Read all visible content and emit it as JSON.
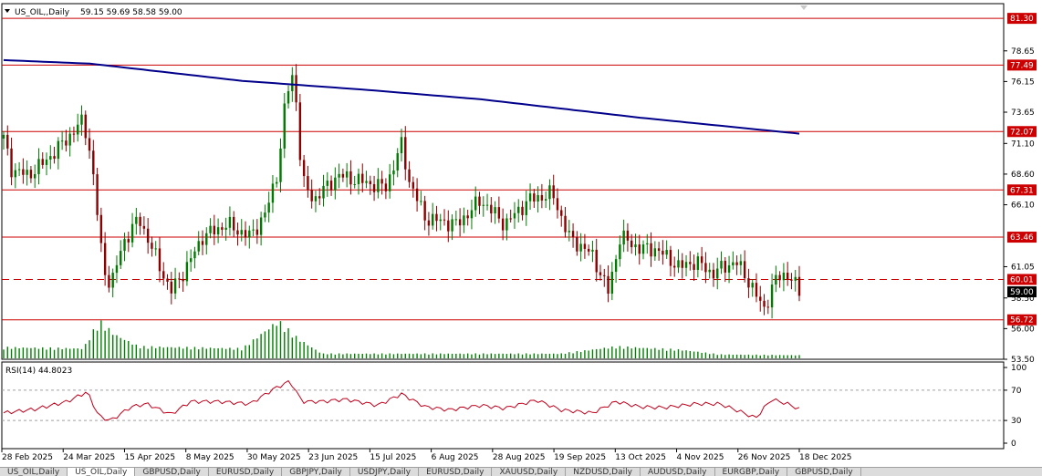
{
  "header": {
    "symbol": "US_OIL,,Daily",
    "ohlc": "59.15 59.69 58.58 59.00"
  },
  "rsi": {
    "label": "RSI(14) 44.8023",
    "value": 44.8023,
    "levels": [
      70,
      30
    ],
    "ticks": [
      "100",
      "70",
      "30",
      "0"
    ]
  },
  "price_label": "59.00",
  "colors": {
    "bull": "#007a00",
    "bear": "#8b0000",
    "ma": "#00008b",
    "hline": "#cc0000",
    "rsi_line": "#c0001c",
    "volume": "#008000",
    "badge_bg": "#cc0000",
    "badge_text": "#ffffff"
  },
  "tabs": [
    "US_OIL,Daily",
    "US_OIL,Daily",
    "GBPUSD,Daily",
    "EURUSD,Daily",
    "GBPJPY,Daily",
    "USDJPY,Daily",
    "EURUSD,Daily",
    "XAUUSD,Daily",
    "NZDUSD,Daily",
    "AUDUSD,Daily",
    "EURGBP,Daily",
    "GBPUSD,Daily"
  ],
  "chart_data": {
    "type": "candlestick",
    "ylim": [
      53.5,
      82.5
    ],
    "y_ticks": [
      "78.65",
      "76.15",
      "73.65",
      "71.10",
      "68.60",
      "66.10",
      "61.05",
      "58.50",
      "56.00",
      "53.50"
    ],
    "x_ticks": [
      "28 Feb 2025",
      "24 Mar 2025",
      "15 Apr 2025",
      "8 May 2025",
      "30 May 2025",
      "23 Jun 2025",
      "15 Jul 2025",
      "6 Aug 2025",
      "28 Aug 2025",
      "19 Sep 2025",
      "13 Oct 2025",
      "4 Nov 2025",
      "26 Nov 2025",
      "18 Dec 2025"
    ],
    "horizontal_levels": [
      {
        "value": 81.3,
        "label": "81.30",
        "style": "solid"
      },
      {
        "value": 77.49,
        "label": "77.49",
        "style": "solid"
      },
      {
        "value": 72.07,
        "label": "72.07",
        "style": "solid"
      },
      {
        "value": 67.31,
        "label": "67.31",
        "style": "solid"
      },
      {
        "value": 63.46,
        "label": "63.46",
        "style": "solid"
      },
      {
        "value": 60.01,
        "label": "60.01",
        "style": "dashed"
      },
      {
        "value": 56.72,
        "label": "56.72",
        "style": "solid"
      }
    ],
    "current_price": 59.0,
    "ma_line": [
      [
        0,
        77.9
      ],
      [
        0.11,
        77.6
      ],
      [
        0.3,
        76.2
      ],
      [
        0.45,
        75.5
      ],
      [
        0.6,
        74.7
      ],
      [
        0.8,
        73.2
      ],
      [
        1.0,
        71.9
      ]
    ],
    "close_path": [
      [
        0,
        71.5
      ],
      [
        0.01,
        69.0
      ],
      [
        0.03,
        68.5
      ],
      [
        0.05,
        69.5
      ],
      [
        0.08,
        71.5
      ],
      [
        0.1,
        73.0
      ],
      [
        0.11,
        70.0
      ],
      [
        0.125,
        61.0
      ],
      [
        0.135,
        59.5
      ],
      [
        0.15,
        63.0
      ],
      [
        0.17,
        65.0
      ],
      [
        0.19,
        62.0
      ],
      [
        0.21,
        59.0
      ],
      [
        0.23,
        61.0
      ],
      [
        0.25,
        63.5
      ],
      [
        0.28,
        64.5
      ],
      [
        0.31,
        63.5
      ],
      [
        0.33,
        65.5
      ],
      [
        0.345,
        69.0
      ],
      [
        0.355,
        75.0
      ],
      [
        0.365,
        77.0
      ],
      [
        0.375,
        68.0
      ],
      [
        0.39,
        66.5
      ],
      [
        0.42,
        68.5
      ],
      [
        0.45,
        68.0
      ],
      [
        0.48,
        67.5
      ],
      [
        0.5,
        71.0
      ],
      [
        0.51,
        68.0
      ],
      [
        0.53,
        65.0
      ],
      [
        0.57,
        64.5
      ],
      [
        0.6,
        66.5
      ],
      [
        0.63,
        64.5
      ],
      [
        0.66,
        66.5
      ],
      [
        0.69,
        67.0
      ],
      [
        0.71,
        63.5
      ],
      [
        0.74,
        62.0
      ],
      [
        0.76,
        59.0
      ],
      [
        0.775,
        63.5
      ],
      [
        0.8,
        62.5
      ],
      [
        0.82,
        62.5
      ],
      [
        0.85,
        61.0
      ],
      [
        0.87,
        61.5
      ],
      [
        0.89,
        60.5
      ],
      [
        0.92,
        61.5
      ],
      [
        0.94,
        59.5
      ],
      [
        0.955,
        57.5
      ],
      [
        0.97,
        60.0
      ],
      [
        0.985,
        60.5
      ],
      [
        1.0,
        59.0
      ]
    ],
    "volume_path": [
      [
        0,
        0.28
      ],
      [
        0.1,
        0.25
      ],
      [
        0.12,
        0.95
      ],
      [
        0.14,
        0.6
      ],
      [
        0.17,
        0.3
      ],
      [
        0.3,
        0.25
      ],
      [
        0.345,
        0.95
      ],
      [
        0.37,
        0.5
      ],
      [
        0.4,
        0.12
      ],
      [
        0.7,
        0.12
      ],
      [
        0.77,
        0.3
      ],
      [
        0.85,
        0.22
      ],
      [
        0.9,
        0.1
      ],
      [
        1.0,
        0.08
      ]
    ],
    "rsi_path": [
      [
        0,
        40
      ],
      [
        0.04,
        45
      ],
      [
        0.08,
        55
      ],
      [
        0.105,
        68
      ],
      [
        0.12,
        35
      ],
      [
        0.135,
        30
      ],
      [
        0.16,
        48
      ],
      [
        0.18,
        52
      ],
      [
        0.21,
        38
      ],
      [
        0.235,
        55
      ],
      [
        0.27,
        55
      ],
      [
        0.31,
        52
      ],
      [
        0.34,
        72
      ],
      [
        0.36,
        82
      ],
      [
        0.375,
        55
      ],
      [
        0.4,
        55
      ],
      [
        0.43,
        58
      ],
      [
        0.47,
        50
      ],
      [
        0.5,
        65
      ],
      [
        0.53,
        48
      ],
      [
        0.56,
        44
      ],
      [
        0.6,
        50
      ],
      [
        0.63,
        46
      ],
      [
        0.67,
        57
      ],
      [
        0.7,
        44
      ],
      [
        0.74,
        40
      ],
      [
        0.77,
        55
      ],
      [
        0.8,
        48
      ],
      [
        0.83,
        47
      ],
      [
        0.87,
        52
      ],
      [
        0.9,
        52
      ],
      [
        0.93,
        40
      ],
      [
        0.945,
        33
      ],
      [
        0.965,
        58
      ],
      [
        0.985,
        52
      ],
      [
        1.0,
        45
      ]
    ]
  }
}
